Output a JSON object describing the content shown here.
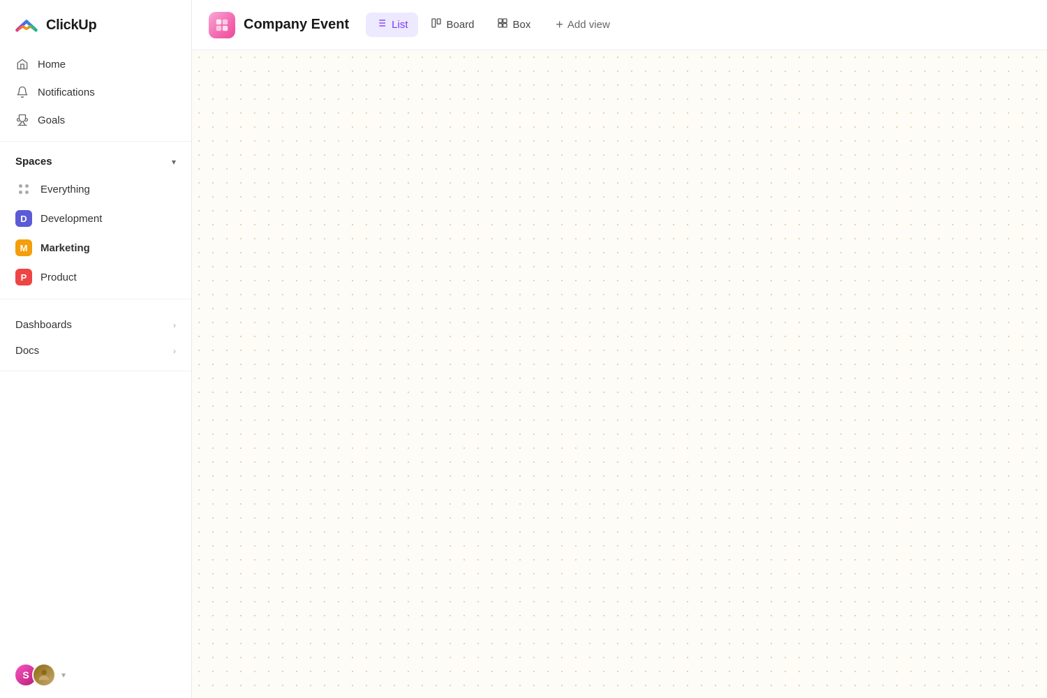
{
  "app": {
    "name": "ClickUp"
  },
  "sidebar": {
    "nav_items": [
      {
        "id": "home",
        "label": "Home",
        "icon": "home"
      },
      {
        "id": "notifications",
        "label": "Notifications",
        "icon": "bell"
      },
      {
        "id": "goals",
        "label": "Goals",
        "icon": "trophy"
      }
    ],
    "spaces": {
      "title": "Spaces",
      "items": [
        {
          "id": "everything",
          "label": "Everything",
          "type": "dots"
        },
        {
          "id": "development",
          "label": "Development",
          "type": "avatar",
          "color": "#5b5bd6",
          "letter": "D"
        },
        {
          "id": "marketing",
          "label": "Marketing",
          "type": "avatar",
          "color": "#f59e0b",
          "letter": "M",
          "bold": true
        },
        {
          "id": "product",
          "label": "Product",
          "type": "avatar",
          "color": "#ef4444",
          "letter": "P"
        }
      ]
    },
    "sections": [
      {
        "id": "dashboards",
        "label": "Dashboards"
      },
      {
        "id": "docs",
        "label": "Docs"
      }
    ]
  },
  "topbar": {
    "project_title": "Company Event",
    "views": [
      {
        "id": "list",
        "label": "List",
        "active": true
      },
      {
        "id": "board",
        "label": "Board",
        "active": false
      },
      {
        "id": "box",
        "label": "Box",
        "active": false
      }
    ],
    "add_view_label": "Add view"
  },
  "footer": {
    "chevron": "▾"
  }
}
